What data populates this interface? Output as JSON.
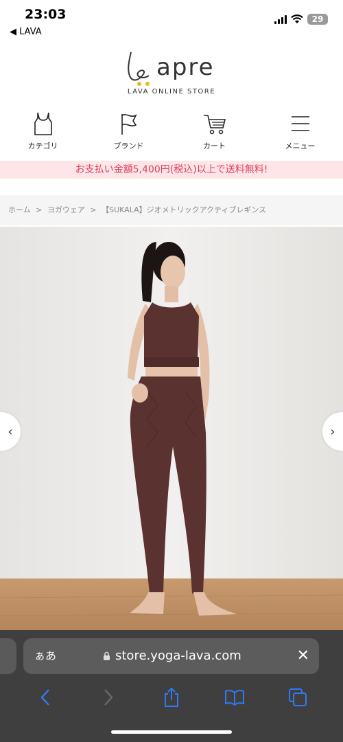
{
  "status_bar": {
    "time": "23:03",
    "back_label": "◀ LAVA",
    "battery": "29"
  },
  "logo": {
    "word": "apre",
    "subtitle": "LAVA ONLINE STORE"
  },
  "nav": {
    "items": [
      {
        "label": "カテゴリ",
        "icon": "tank-top-icon"
      },
      {
        "label": "ブランド",
        "icon": "flag-icon"
      },
      {
        "label": "カート",
        "icon": "cart-icon"
      },
      {
        "label": "メニュー",
        "icon": "hamburger-menu-icon"
      }
    ]
  },
  "banner": {
    "text": "お支払い金額5,400円(税込)以上で送料無料!"
  },
  "breadcrumb": {
    "items": [
      "ホーム",
      ">",
      "ヨガウェア",
      ">",
      "【SUKALA】ジオメトリックアクティブレギンス"
    ]
  },
  "hero": {
    "prev_label": "‹",
    "next_label": "›"
  },
  "safari": {
    "aa_label": "ぁあ",
    "url": "store.yoga-lava.com",
    "close_label": "✕"
  },
  "colors": {
    "banner_bg": "#fde5e8",
    "banner_text": "#e0405a",
    "safari_bg": "#3f3f3f",
    "accent_blue": "#2f7bf6",
    "outfit": "#5a3230"
  }
}
